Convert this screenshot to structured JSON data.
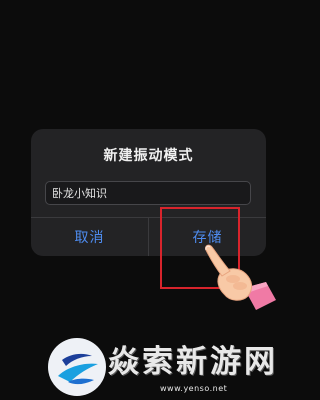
{
  "dialog": {
    "title": "新建振动模式",
    "input_value": "卧龙小知识",
    "cancel_label": "取消",
    "save_label": "存储"
  },
  "watermark": {
    "title": "焱索新游网",
    "url": "www.yenso.net"
  },
  "colors": {
    "background": "#0c0c0c",
    "dialog_bg": "#232325",
    "button_text": "#4e8cf0",
    "highlight": "#d8242c"
  },
  "icons": [
    "pointing-hand-icon",
    "site-logo-icon"
  ]
}
